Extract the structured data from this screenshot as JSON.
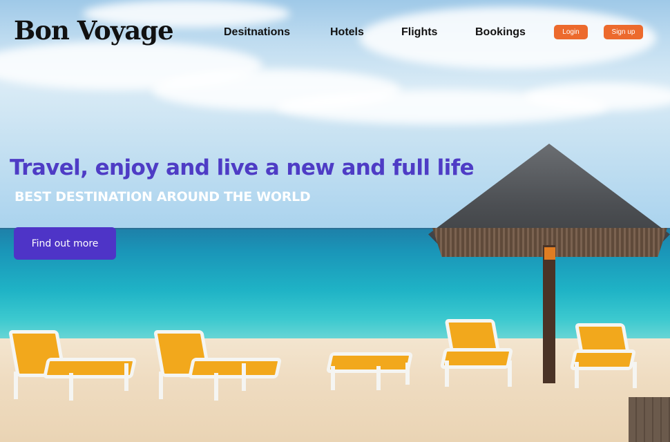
{
  "header": {
    "logo": "Bon Voyage",
    "nav": [
      "Desitnations",
      "Hotels",
      "Flights",
      "Bookings"
    ],
    "login_label": "Login",
    "signup_label": "Sign up"
  },
  "hero": {
    "headline": "Travel, enjoy and live a new and full life",
    "subheading": "BEST DESTINATION AROUND THE WORLD",
    "cta_label": "Find out more"
  },
  "colors": {
    "accent_purple": "#4e34c7",
    "headline_purple": "#4e3cc5",
    "button_orange": "#ec6a2d"
  }
}
